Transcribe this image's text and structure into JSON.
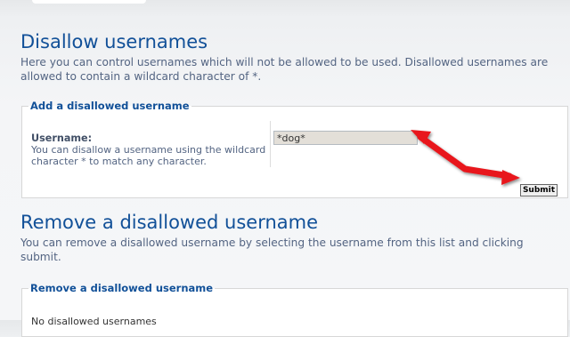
{
  "page": {
    "title": "Disallow usernames",
    "description": "Here you can control usernames which will not be allowed to be used. Disallowed usernames are allowed to contain a wildcard character of *."
  },
  "add_form": {
    "legend": "Add a disallowed username",
    "field_label": "Username:",
    "field_help": "You can disallow a username using the wildcard character * to match any character.",
    "input_value": "*dog*",
    "submit_label": "Submit"
  },
  "remove_section": {
    "title": "Remove a disallowed username",
    "description": "You can remove a disallowed username by selecting the username from this list and clicking submit.",
    "legend": "Remove a disallowed username",
    "empty_message": "No disallowed usernames"
  },
  "colors": {
    "heading": "#115098",
    "text": "#536482",
    "annotation_arrow": "#e8161a"
  }
}
